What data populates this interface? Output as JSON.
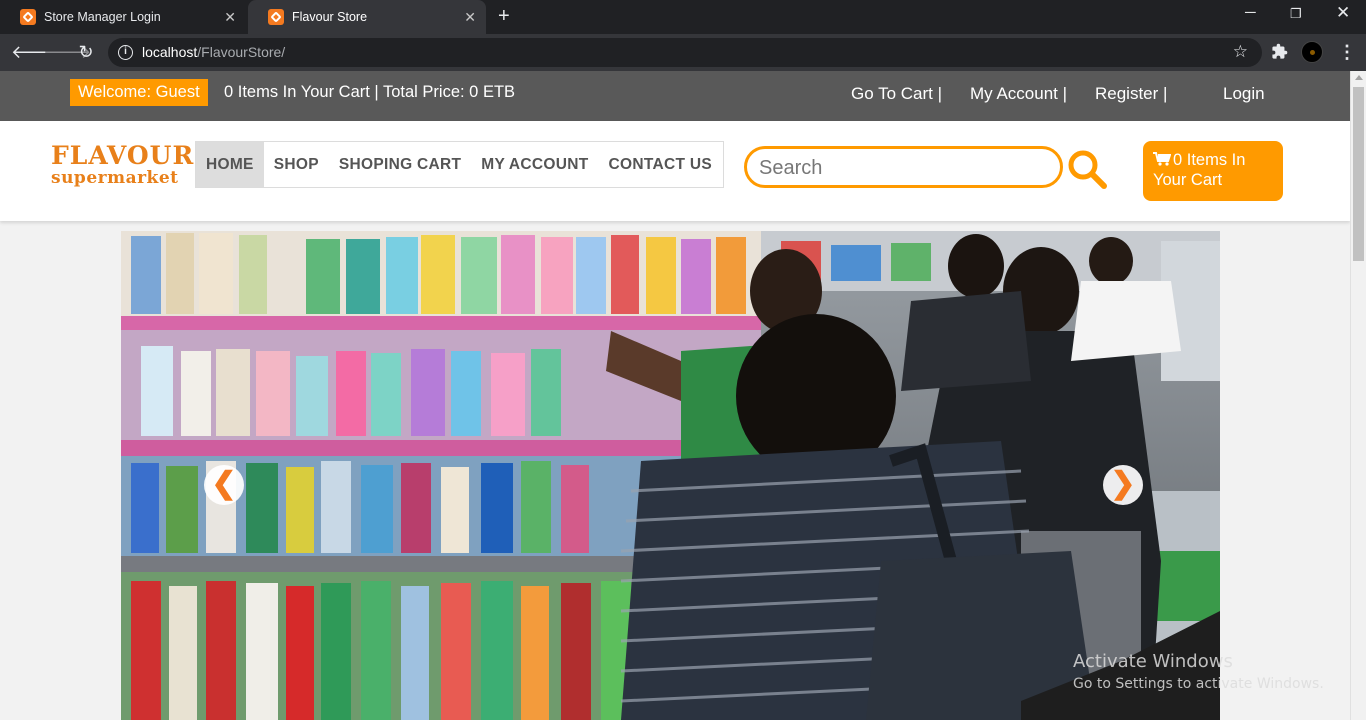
{
  "browser": {
    "tabs": [
      {
        "title": "Store Manager Login"
      },
      {
        "title": "Flavour Store"
      }
    ],
    "url_host": "localhost",
    "url_path": "/FlavourStore/"
  },
  "topbar": {
    "welcome": "Welcome: Guest",
    "cart_info": "0 Items In Your Cart | Total Price: 0 ETB",
    "links": {
      "go_to_cart": "Go To Cart |",
      "my_account": "My Account |",
      "register": "Register |",
      "login": "Login"
    }
  },
  "logo": {
    "line1": "FLAVOUR",
    "line2": "supermarket"
  },
  "nav": {
    "items": [
      "HOME",
      "SHOP",
      "SHOPING CART",
      "MY ACCOUNT",
      "CONTACT US"
    ],
    "active": "HOME"
  },
  "search": {
    "placeholder": "Search"
  },
  "cart_button": {
    "label": "0 Items In Your Cart"
  },
  "carousel": {
    "prev": "❮",
    "next": "❯"
  },
  "watermark": {
    "line1": "Activate Windows",
    "line2": "Go to Settings to activate Windows."
  },
  "colors": {
    "accent": "#ff9a00",
    "topbar": "#595959",
    "tab_bar": "#202124"
  }
}
